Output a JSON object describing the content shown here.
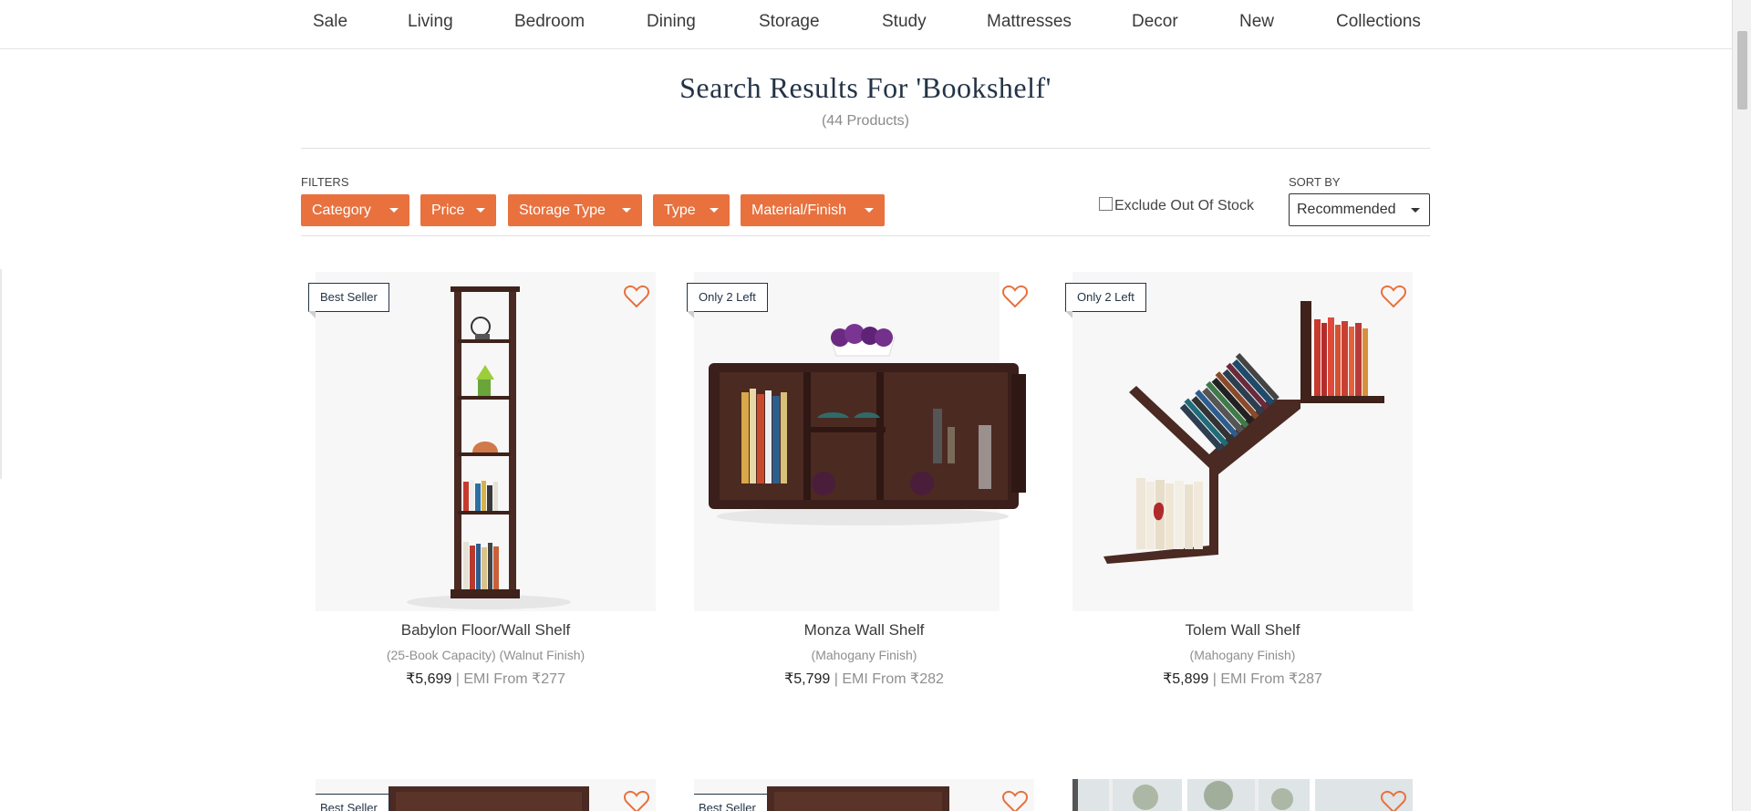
{
  "nav": {
    "items": [
      "Sale",
      "Living",
      "Bedroom",
      "Dining",
      "Storage",
      "Study",
      "Mattresses",
      "Decor",
      "New",
      "Collections"
    ]
  },
  "search": {
    "title": "Search Results For 'Bookshelf'",
    "count": "(44 Products)"
  },
  "filters": {
    "label": "FILTERS",
    "buttons": [
      "Category",
      "Price",
      "Storage Type",
      "Type",
      "Material/Finish"
    ],
    "exclude_label": "Exclude Out Of Stock",
    "exclude_checked": false,
    "sort_label": "SORT BY",
    "sort_value": "Recommended"
  },
  "products": [
    {
      "badge": "Best Seller",
      "name": "Babylon Floor/Wall Shelf",
      "sub": "(25-Book Capacity) (Walnut Finish)",
      "price": "₹5,699",
      "emi": " | EMI From ₹277"
    },
    {
      "badge": "Only 2 Left",
      "name": "Monza Wall Shelf",
      "sub": "(Mahogany Finish)",
      "price": "₹5,799",
      "emi": " | EMI From ₹282"
    },
    {
      "badge": "Only 2 Left",
      "name": "Tolem Wall Shelf",
      "sub": "(Mahogany Finish)",
      "price": "₹5,899",
      "emi": " | EMI From ₹287"
    }
  ],
  "next_row_badges": [
    "Best Seller",
    "Best Seller"
  ],
  "colors": {
    "accent": "#e8713e",
    "title": "#243447",
    "wood": "#4a2a22"
  }
}
